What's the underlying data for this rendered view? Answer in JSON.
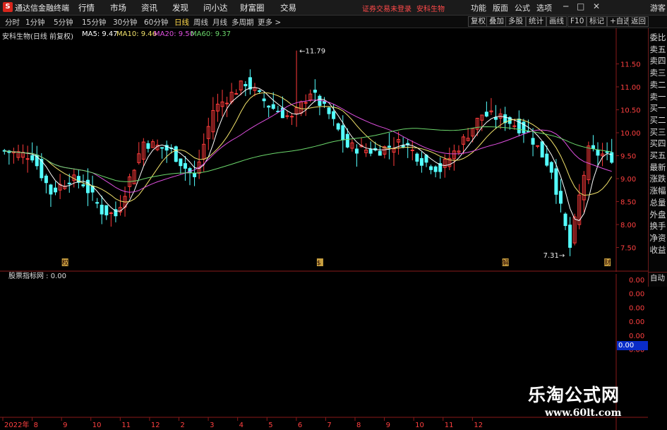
{
  "titlebar": {
    "app_title": "通达信金融终端",
    "menus": [
      "行情",
      "市场",
      "资讯",
      "发现",
      "问小达",
      "财富圈",
      "交易"
    ],
    "login_status": "证券交易未登录",
    "stock_name": "安科生物",
    "right_menus": [
      "功能",
      "版面",
      "公式",
      "选项"
    ],
    "guest_label": "游客",
    "window_controls": [
      "─",
      "□",
      "✕"
    ]
  },
  "toolbar": {
    "periods": [
      "分时",
      "1分钟",
      "5分钟",
      "15分钟",
      "30分钟",
      "60分钟",
      "日线",
      "周线",
      "月线",
      "多周期",
      "更多 >"
    ],
    "active_period": "日线",
    "buttons": [
      "复权",
      "叠加",
      "多股",
      "统计",
      "画线",
      "F10",
      "标记",
      "+自选",
      "返回"
    ]
  },
  "chart_header": {
    "title": "安科生物(日线 前复权)",
    "ma5": "MA5: 9.47",
    "ma10": "MA10: 9.46",
    "ma20": "MA20: 9.50",
    "ma60": "MA60: 9.37"
  },
  "colors": {
    "up": "#ff3b3b",
    "down": "#54ffff",
    "ma5": "#ffffff",
    "ma10": "#f2e26b",
    "ma20": "#e050e0",
    "ma60": "#6cd86c",
    "grid": "#8a1a1a",
    "axis_text": "#ff4040"
  },
  "side_panel": {
    "items": [
      "委比",
      "卖五",
      "卖四",
      "卖三",
      "卖二",
      "卖一",
      "买一",
      "买二",
      "买三",
      "买四",
      "买五",
      "最新",
      "涨跌",
      "涨幅",
      "总量",
      "外盘",
      "换手",
      "净资",
      "收益"
    ],
    "auto_button": "自动"
  },
  "indicator": {
    "label": "股票指标网 : 0.00",
    "current_value": "0.00"
  },
  "watermark": {
    "line1": "乐淘公式网",
    "line2": "www.60lt.com"
  },
  "markers": [
    {
      "label": "权",
      "x_index": 13
    },
    {
      "label": "$",
      "x_index": 68
    },
    {
      "label": "解",
      "x_index": 108
    },
    {
      "label": "财",
      "x_index": 130
    }
  ],
  "chart_data": [
    {
      "type": "candlestick",
      "title": "安科生物(日线 前复权)",
      "y_ticks": [
        7.5,
        8.0,
        8.5,
        9.0,
        9.5,
        10.0,
        10.5,
        11.0,
        11.5
      ],
      "ylim": [
        7.2,
        12.0
      ],
      "max_label": "11.79",
      "min_label": "7.31",
      "x_tick_labels": [
        "2022年",
        "8",
        "9",
        "10",
        "11",
        "12",
        "2",
        "3",
        "4",
        "5",
        "6",
        "7",
        "8",
        "9",
        "10",
        "11",
        "12"
      ],
      "anchor_closes": [
        [
          0,
          9.6
        ],
        [
          6,
          9.5
        ],
        [
          10,
          8.7
        ],
        [
          14,
          9.0
        ],
        [
          17,
          8.9
        ],
        [
          21,
          8.3
        ],
        [
          24,
          8.2
        ],
        [
          30,
          9.8
        ],
        [
          36,
          9.6
        ],
        [
          41,
          9.0
        ],
        [
          45,
          10.5
        ],
        [
          52,
          11.1
        ],
        [
          57,
          10.6
        ],
        [
          62,
          10.3
        ],
        [
          66,
          10.9
        ],
        [
          70,
          10.4
        ],
        [
          74,
          9.7
        ],
        [
          80,
          9.6
        ],
        [
          86,
          9.8
        ],
        [
          90,
          9.4
        ],
        [
          94,
          9.2
        ],
        [
          98,
          9.7
        ],
        [
          103,
          10.4
        ],
        [
          108,
          10.3
        ],
        [
          113,
          10.0
        ],
        [
          118,
          9.2
        ],
        [
          122,
          7.5
        ],
        [
          124,
          8.6
        ],
        [
          126,
          9.6
        ],
        [
          131,
          9.47
        ]
      ],
      "extreme_candles": [
        [
          63,
          11.79,
          "high"
        ],
        [
          122,
          7.31,
          "low"
        ]
      ],
      "ma_values": {
        "MA5": 9.47,
        "MA10": 9.46,
        "MA20": 9.5,
        "MA60": 9.37
      }
    },
    {
      "type": "line",
      "title": "股票指标网",
      "y_ticks": [
        0.0,
        0.0,
        0.0,
        0.0,
        0.0,
        0.0
      ],
      "values": [
        0.0
      ]
    }
  ]
}
